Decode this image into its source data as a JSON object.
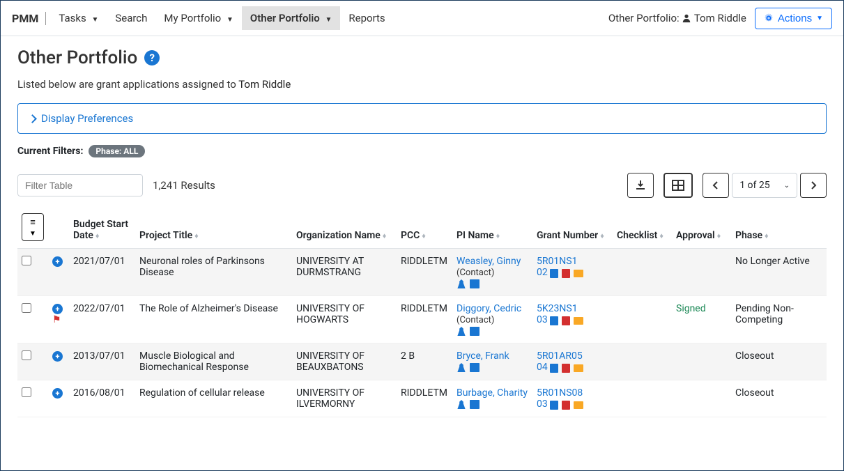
{
  "brand": "PMM",
  "nav": {
    "tasks": "Tasks",
    "search": "Search",
    "my_portfolio": "My Portfolio",
    "other_portfolio": "Other Portfolio",
    "reports": "Reports"
  },
  "owner_label": "Other Portfolio:",
  "owner_name": "Tom Riddle",
  "actions_label": "Actions",
  "page_title": "Other Portfolio",
  "subtitle_prefix": "Listed below are grant applications assigned to",
  "subtitle_owner": "Tom Riddle",
  "display_prefs": "Display Preferences",
  "filters_label": "Current Filters:",
  "filter_chip": "Phase: ALL",
  "filter_placeholder": "Filter Table",
  "results_count": "1,241 Results",
  "page_label": "1 of 25",
  "columns": {
    "budget_start": "Budget Start Date",
    "project_title": "Project Title",
    "org_name": "Organization Name",
    "pcc": "PCC",
    "pi_name": "PI Name",
    "grant_number": "Grant Number",
    "checklist": "Checklist",
    "approval": "Approval",
    "phase": "Phase"
  },
  "rows": [
    {
      "flagged": false,
      "budget_start": "2021/07/01",
      "project_title": "Neuronal roles of Parkinsons Disease",
      "org_name": "UNIVERSITY AT DURMSTRANG",
      "pcc": "RIDDLETM",
      "pi_name": "Weasley, Ginny",
      "pi_contact": "(Contact)",
      "grant_line1": "5R01NS1",
      "grant_line2": "02",
      "checklist": "",
      "approval": "",
      "phase": "No Longer Active"
    },
    {
      "flagged": true,
      "budget_start": "2022/07/01",
      "project_title": "The Role of Alzheimer's Disease",
      "org_name": "UNIVERSITY OF HOGWARTS",
      "pcc": "RIDDLETM",
      "pi_name": "Diggory, Cedric",
      "pi_contact": "(Contact)",
      "grant_line1": "5K23NS1",
      "grant_line2": "03",
      "checklist": "",
      "approval": "Signed",
      "phase": "Pending Non-Competing"
    },
    {
      "flagged": false,
      "budget_start": "2013/07/01",
      "project_title": "Muscle Biological and Biomechanical Response",
      "org_name": "UNIVERSITY OF BEAUXBATONS",
      "pcc": "2 B",
      "pi_name": "Bryce, Frank",
      "pi_contact": "",
      "grant_line1": "5R01AR05",
      "grant_line2": "04",
      "checklist": "",
      "approval": "",
      "phase": "Closeout"
    },
    {
      "flagged": false,
      "budget_start": "2016/08/01",
      "project_title": "Regulation of cellular release",
      "org_name": "UNIVERSITY OF ILVERMORNY",
      "pcc": "RIDDLETM",
      "pi_name": "Burbage, Charity",
      "pi_contact": "",
      "grant_line1": "5R01NS08",
      "grant_line2": "03",
      "checklist": "",
      "approval": "",
      "phase": "Closeout"
    }
  ]
}
